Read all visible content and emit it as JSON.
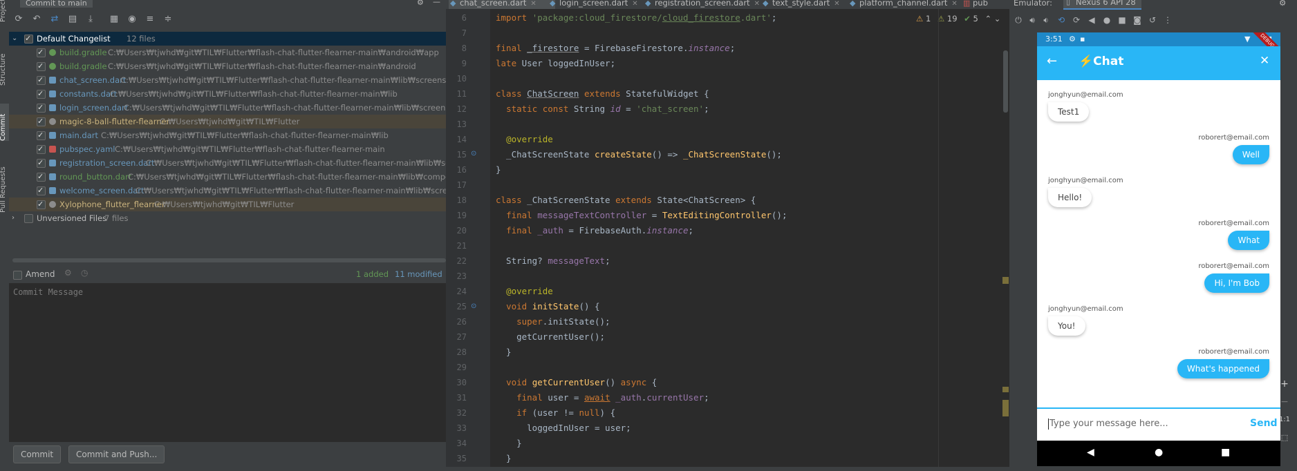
{
  "toolstrip": {
    "tabs": [
      "Project",
      "Structure",
      "Commit",
      "Pull Requests"
    ]
  },
  "commit_panel": {
    "title": "Commit to main",
    "changelist": {
      "name": "Default Changelist",
      "count": "12 files"
    },
    "files": [
      {
        "name": "build.gradle",
        "path": "C:₩Users₩tjwhd₩git₩TIL₩Flutter₩flash-chat-flutter-flearner-main₩android₩app",
        "color": "green",
        "icon": "gradle-icon"
      },
      {
        "name": "build.gradle",
        "path": "C:₩Users₩tjwhd₩git₩TIL₩Flutter₩flash-chat-flutter-flearner-main₩android",
        "color": "green",
        "icon": "gradle-icon"
      },
      {
        "name": "chat_screen.dart",
        "path": "C:₩Users₩tjwhd₩git₩TIL₩Flutter₩flash-chat-flutter-flearner-main₩lib₩screens",
        "color": "blue",
        "icon": "dart-icon"
      },
      {
        "name": "constants.dart",
        "path": "C:₩Users₩tjwhd₩git₩TIL₩Flutter₩flash-chat-flutter-flearner-main₩lib",
        "color": "blue",
        "icon": "dart-icon"
      },
      {
        "name": "login_screen.dart",
        "path": "C:₩Users₩tjwhd₩git₩TIL₩Flutter₩flash-chat-flutter-flearner-main₩lib₩screens",
        "color": "blue",
        "icon": "dart-icon"
      },
      {
        "name": "magic-8-ball-flutter-flearner",
        "path": "C:₩Users₩tjwhd₩git₩TIL₩Flutter",
        "color": "tan",
        "icon": "folder-icon"
      },
      {
        "name": "main.dart",
        "path": "C:₩Users₩tjwhd₩git₩TIL₩Flutter₩flash-chat-flutter-flearner-main₩lib",
        "color": "blue",
        "icon": "dart-icon"
      },
      {
        "name": "pubspec.yaml",
        "path": "C:₩Users₩tjwhd₩git₩TIL₩Flutter₩flash-chat-flutter-flearner-main",
        "color": "blue",
        "icon": "yaml-icon"
      },
      {
        "name": "registration_screen.dart",
        "path": "C:₩Users₩tjwhd₩git₩TIL₩Flutter₩flash-chat-flutter-flearner-main₩lib₩screens",
        "color": "blue",
        "icon": "dart-icon"
      },
      {
        "name": "round_button.dart",
        "path": "C:₩Users₩tjwhd₩git₩TIL₩Flutter₩flash-chat-flutter-flearner-main₩lib₩components",
        "color": "green",
        "icon": "dart-icon"
      },
      {
        "name": "welcome_screen.dart",
        "path": "C:₩Users₩tjwhd₩git₩TIL₩Flutter₩flash-chat-flutter-flearner-main₩lib₩screens",
        "color": "blue",
        "icon": "dart-icon"
      },
      {
        "name": "Xylophone_flutter_flearner",
        "path": "C:₩Users₩tjwhd₩git₩TIL₩Flutter",
        "color": "tan",
        "icon": "folder-icon"
      }
    ],
    "unversioned": {
      "name": "Unversioned Files",
      "count": "7 files"
    },
    "amend_label": "Amend",
    "stats": {
      "added": "1 added",
      "modified": "11 modified"
    },
    "commit_message_placeholder": "Commit Message",
    "commit_button": "Commit",
    "commit_push_button": "Commit and Push..."
  },
  "editor": {
    "tabs": [
      "chat_screen.dart",
      "login_screen.dart",
      "registration_screen.dart",
      "text_style.dart",
      "platform_channel.dart",
      "pub"
    ],
    "inspections": {
      "warnings": "1",
      "weak_warnings": "19",
      "ok": "5"
    },
    "lines": [
      "6",
      "7",
      "8",
      "9",
      "10",
      "11",
      "12",
      "13",
      "14",
      "15",
      "16",
      "17",
      "18",
      "19",
      "20",
      "21",
      "22",
      "23",
      "24",
      "25",
      "26",
      "27",
      "28",
      "29",
      "30",
      "31",
      "32",
      "33",
      "34",
      "35"
    ]
  },
  "emulator": {
    "label": "Emulator:",
    "device": "Nexus 6 API 28",
    "status_time": "3:51",
    "app_title": "⚡️Chat",
    "debug_label": "DEBUG",
    "messages": [
      {
        "sender": "jonghyun@email.com",
        "text": "Test1",
        "me": false
      },
      {
        "sender": "roborert@email.com",
        "text": "Well",
        "me": true
      },
      {
        "sender": "jonghyun@email.com",
        "text": "Hello!",
        "me": false
      },
      {
        "sender": "roborert@email.com",
        "text": "What",
        "me": true
      },
      {
        "sender": "roborert@email.com",
        "text": "Hi, I'm Bob",
        "me": true
      },
      {
        "sender": "jonghyun@email.com",
        "text": "You!",
        "me": false
      },
      {
        "sender": "roborert@email.com",
        "text": "What's happened",
        "me": true
      }
    ],
    "input_placeholder": "Type your message here...",
    "send_label": "Send",
    "zoom": {
      "plus": "+",
      "minus": "−",
      "ratio": "1:1"
    }
  }
}
